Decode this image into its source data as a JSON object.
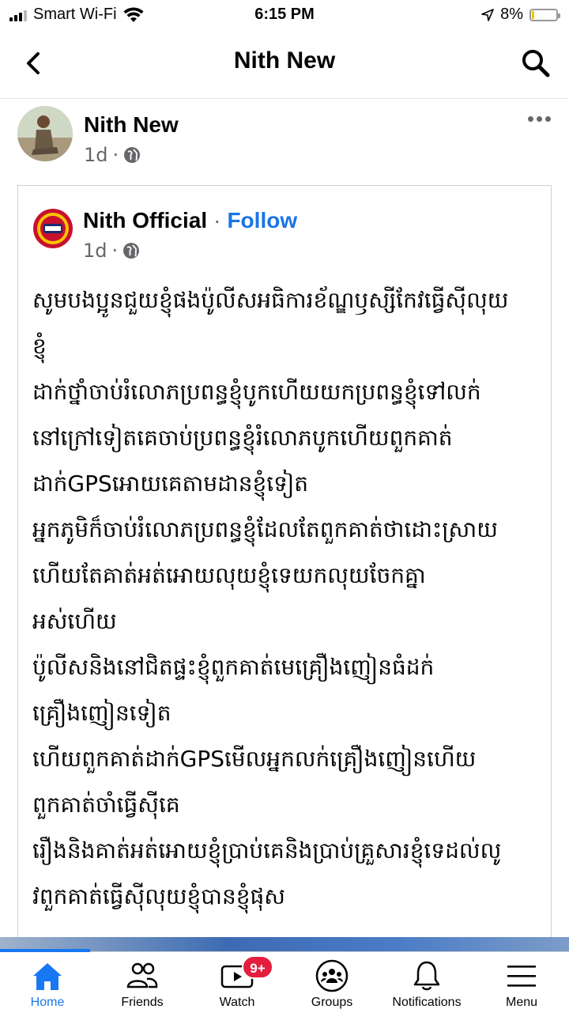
{
  "status_bar": {
    "carrier": "Smart Wi-Fi",
    "time": "6:15 PM",
    "battery": "8%"
  },
  "nav": {
    "title": "Nith New"
  },
  "post": {
    "author": "Nith New",
    "time": "1d",
    "shared": {
      "author": "Nith Official",
      "follow": "Follow",
      "time": "1d",
      "lines": [
        "សូមបងប្អូនជួយខ្ញុំផងប៉ូលីសអធិការខ័ណ្ឌឫស្សីកែវធ្វើស៊ីលុយ",
        "ខ្ញុំ",
        "ដាក់ថ្នាំចាប់រំលោភប្រពន្ធខ្ញុំបូកហើយយកប្រពន្ធខ្ញុំទៅលក់",
        "នៅក្រៅទៀតគេចាប់ប្រពន្ធខ្ញុំរំលោភបូកហើយពួកគាត់",
        "ដាក់GPSអោយគេតាមដានខ្ញុំទៀត",
        "អ្នកភូមិក៏ចាប់រំលោភប្រពន្ធខ្ញុំដែលតែពួកគាត់ថាដោះស្រាយ",
        "ហើយតែគាត់អត់អោយលុយខ្ញុំទេយកលុយចែកគ្នា",
        "អស់ហើយ",
        "ប៉ូលីសនិងនៅជិតផ្ទះខ្ញុំពួកគាត់មេគ្រឿងញៀនធំដក់",
        "គ្រឿងញៀនទៀត",
        "ហើយពួកគាត់ដាក់GPSមើលអ្នកលក់គ្រឿងញៀនហើយ",
        "ពួកគាត់ចាំធ្វើស៊ីគេ",
        "រឿងនិងគាត់អត់អោយខ្ញុំប្រាប់គេនិងប្រាប់គ្រួសារខ្ញុំទេដល់លូ",
        "វពួកគាត់ធ្វើស៊ីលុយខ្ញុំបានខ្ញុំផុស"
      ]
    }
  },
  "tabs": [
    {
      "label": "Home"
    },
    {
      "label": "Friends"
    },
    {
      "label": "Watch",
      "badge": "9+"
    },
    {
      "label": "Groups"
    },
    {
      "label": "Notifications"
    },
    {
      "label": "Menu"
    }
  ],
  "colors": {
    "accent": "#1877f2",
    "badge": "#e41e3f",
    "meta": "#65676b"
  }
}
